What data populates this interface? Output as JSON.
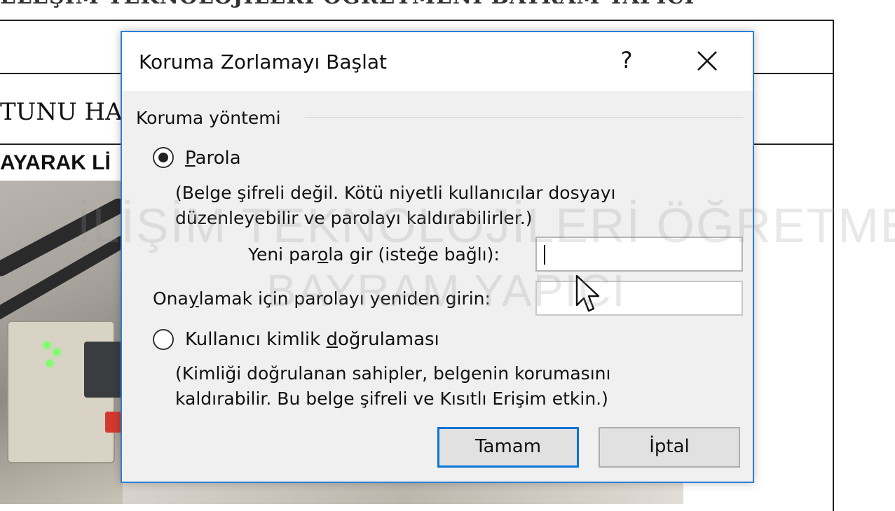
{
  "document": {
    "heading": "ELEŞİM TEKNOLOJİLERİ ÖĞRETMENİ BAYRAM YAPICI",
    "cell_text_1": "TUNU HAS",
    "cell_text_2": "AYARAK Lİ"
  },
  "watermark": {
    "line1": "İLİŞİM TEKNOLOJİLERİ ÖĞRETMENİ",
    "line2": "BAYRAM YAPICI"
  },
  "dialog": {
    "title": "Koruma Zorlamayı Başlat",
    "help_label": "?",
    "group_label": "Koruma yöntemi",
    "option_password": {
      "label_prefix": "",
      "label_accel": "P",
      "label_suffix": "arola",
      "selected": true,
      "description_line1": "(Belge şifreli değil. Kötü niyetli kullanıcılar dosyayı",
      "description_line2": "düzenleyebilir ve parolayı kaldırabilirler.)"
    },
    "new_password": {
      "label_prefix": "Yeni par",
      "label_accel": "o",
      "label_suffix": "la gir (isteğe bağlı):",
      "value": ""
    },
    "confirm_password": {
      "label_prefix": "Ona",
      "label_accel": "y",
      "label_suffix": "lamak için parolayı yeniden girin:",
      "value": ""
    },
    "option_identity": {
      "label_prefix": "Kullanıcı kimlik ",
      "label_accel": "d",
      "label_suffix": "oğrulaması",
      "selected": false,
      "description_line1": "(Kimliği doğrulanan sahipler, belgenin korumasını",
      "description_line2": "kaldırabilir. Bu belge şifreli ve Kısıtlı Erişim etkin.)"
    },
    "ok_label": "Tamam",
    "cancel_label": "İptal"
  },
  "colors": {
    "accent": "#2b7fd6",
    "dialog_bg": "#f0f0f0",
    "button_bg": "#e1e1e1"
  },
  "icons": {
    "close": "close-x-icon",
    "pointer": "mouse-pointer-icon"
  }
}
